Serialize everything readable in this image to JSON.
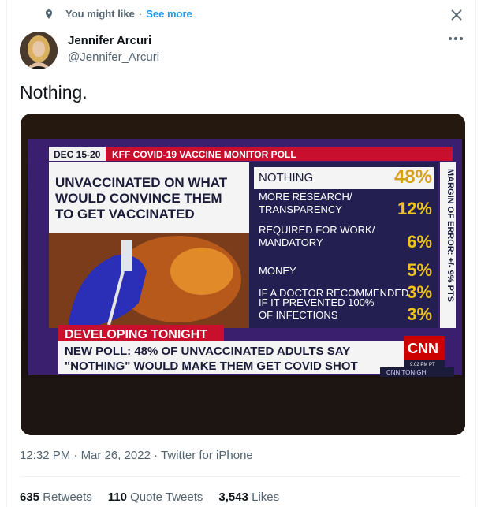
{
  "context": {
    "label": "You might like",
    "separator": "·",
    "link": "See more"
  },
  "author": {
    "name": "Jennifer Arcuri",
    "handle": "@Jennifer_Arcuri"
  },
  "tweet": {
    "text": "Nothing."
  },
  "media": {
    "date_banner": "DEC 15-20",
    "poll_name": "KFF COVID-19 VACCINE MONITOR POLL",
    "question": [
      "UNVACCINATED ON WHAT",
      "WOULD CONVINCE THEM",
      "TO GET VACCINATED"
    ],
    "rows": [
      {
        "label": [
          "NOTHING"
        ],
        "value": "48%"
      },
      {
        "label": [
          "MORE RESEARCH/",
          "TRANSPARENCY"
        ],
        "value": "12%"
      },
      {
        "label": [
          "REQUIRED FOR WORK/",
          "MANDATORY"
        ],
        "value": "6%"
      },
      {
        "label": [
          "MONEY"
        ],
        "value": "5%"
      },
      {
        "label": [
          "IF A DOCTOR RECOMMENDED"
        ],
        "value": "3%"
      },
      {
        "label": [
          "IF IT PREVENTED 100%",
          "OF INFECTIONS"
        ],
        "value": "3%"
      }
    ],
    "margin_of_error": "MARGIN OF ERROR: +/- 9% PTS",
    "developing": "DEVELOPING TONIGHT",
    "headline": [
      "NEW POLL: 48% OF UNVACCINATED ADULTS SAY",
      "\"NOTHING\" WOULD MAKE THEM GET COVID SHOT"
    ],
    "network": "CNN",
    "time": "9:02 PM PT",
    "show": "CNN TONIGH"
  },
  "meta": {
    "time": "12:32 PM",
    "dot1": "·",
    "date": "Mar 26, 2022",
    "dot2": "·",
    "source": "Twitter for iPhone"
  },
  "stats": {
    "retweets": "635",
    "retweets_label": "Retweets",
    "quotes": "110",
    "quotes_label": "Quote Tweets",
    "likes": "3,543",
    "likes_label": "Likes"
  },
  "colors": {
    "accent": "#1d9bf0",
    "secondary": "#536471",
    "cnn_red": "#cc0000"
  }
}
